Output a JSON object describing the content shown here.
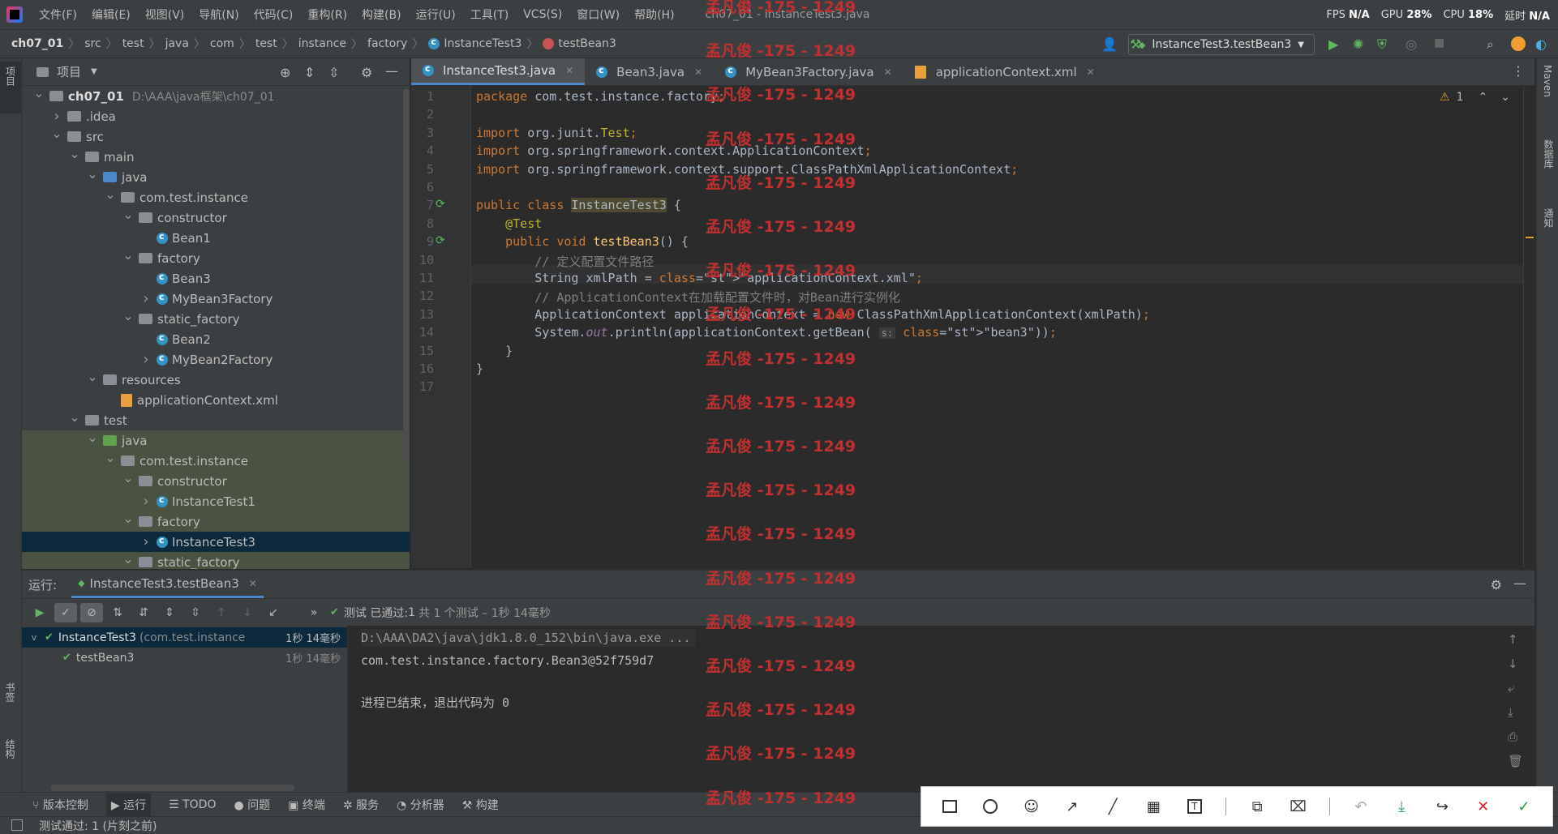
{
  "menubar": {
    "items": [
      "文件(F)",
      "编辑(E)",
      "视图(V)",
      "导航(N)",
      "代码(C)",
      "重构(R)",
      "构建(B)",
      "运行(U)",
      "工具(T)",
      "VCS(S)",
      "窗口(W)",
      "帮助(H)"
    ],
    "window_title": "ch07_01 - InstanceTest3.java",
    "fps_label": "FPS",
    "fps_value": "N/A",
    "gpu_label": "GPU",
    "gpu_value": "28%",
    "cpu_label": "CPU",
    "cpu_value": "18%",
    "latency_label": "延时",
    "latency_value": "N/A"
  },
  "breadcrumb": {
    "items": [
      "ch07_01",
      "src",
      "test",
      "java",
      "com",
      "test",
      "instance",
      "factory",
      "InstanceTest3",
      "testBean3"
    ],
    "run_config": "InstanceTest3.testBean3"
  },
  "left_strip": {
    "project": "项目",
    "bookmarks": "书签",
    "structure": "结构"
  },
  "right_strip": {
    "maven": "Maven",
    "database": "数据库",
    "notifications": "通知"
  },
  "project_panel": {
    "title": "项目",
    "tree": [
      {
        "label": "ch07_01",
        "extra": "D:\\AAA\\java框架\\ch07_01",
        "indent": 0,
        "arrow": "v",
        "icon": "folder"
      },
      {
        "label": ".idea",
        "indent": 1,
        "arrow": ">",
        "icon": "folder"
      },
      {
        "label": "src",
        "indent": 1,
        "arrow": "v",
        "icon": "folder"
      },
      {
        "label": "main",
        "indent": 2,
        "arrow": "v",
        "icon": "folder"
      },
      {
        "label": "java",
        "indent": 3,
        "arrow": "v",
        "icon": "folder-blue"
      },
      {
        "label": "com.test.instance",
        "indent": 4,
        "arrow": "v",
        "icon": "package"
      },
      {
        "label": "constructor",
        "indent": 5,
        "arrow": "v",
        "icon": "package"
      },
      {
        "label": "Bean1",
        "indent": 6,
        "arrow": "",
        "icon": "class"
      },
      {
        "label": "factory",
        "indent": 5,
        "arrow": "v",
        "icon": "package"
      },
      {
        "label": "Bean3",
        "indent": 6,
        "arrow": "",
        "icon": "class"
      },
      {
        "label": "MyBean3Factory",
        "indent": 6,
        "arrow": ">",
        "icon": "class"
      },
      {
        "label": "static_factory",
        "indent": 5,
        "arrow": "v",
        "icon": "package"
      },
      {
        "label": "Bean2",
        "indent": 6,
        "arrow": "",
        "icon": "class"
      },
      {
        "label": "MyBean2Factory",
        "indent": 6,
        "arrow": ">",
        "icon": "class"
      },
      {
        "label": "resources",
        "indent": 3,
        "arrow": "v",
        "icon": "folder"
      },
      {
        "label": "applicationContext.xml",
        "indent": 4,
        "arrow": "",
        "icon": "xml"
      },
      {
        "label": "test",
        "indent": 2,
        "arrow": "v",
        "icon": "folder"
      },
      {
        "label": "java",
        "indent": 3,
        "arrow": "v",
        "icon": "folder-green",
        "hl": true
      },
      {
        "label": "com.test.instance",
        "indent": 4,
        "arrow": "v",
        "icon": "package",
        "hl": true
      },
      {
        "label": "constructor",
        "indent": 5,
        "arrow": "v",
        "icon": "package",
        "hl": true
      },
      {
        "label": "InstanceTest1",
        "indent": 6,
        "arrow": ">",
        "icon": "class",
        "hl": true
      },
      {
        "label": "factory",
        "indent": 5,
        "arrow": "v",
        "icon": "package",
        "hl": true
      },
      {
        "label": "InstanceTest3",
        "indent": 6,
        "arrow": ">",
        "icon": "class",
        "sel": true
      },
      {
        "label": "static_factory",
        "indent": 5,
        "arrow": "v",
        "icon": "package",
        "hl": true
      }
    ]
  },
  "tabs": [
    {
      "label": "InstanceTest3.java",
      "icon": "class",
      "active": true
    },
    {
      "label": "Bean3.java",
      "icon": "class",
      "active": false
    },
    {
      "label": "MyBean3Factory.java",
      "icon": "class",
      "active": false
    },
    {
      "label": "applicationContext.xml",
      "icon": "xml",
      "active": false
    }
  ],
  "editor": {
    "warnings": "1",
    "lines": [
      "package com.test.instance.factory;",
      "",
      "import org.junit.Test;",
      "import org.springframework.context.ApplicationContext;",
      "import org.springframework.context.support.ClassPathXmlApplicationContext;",
      "",
      "public class InstanceTest3 {",
      "    @Test",
      "    public void testBean3() {",
      "        // 定义配置文件路径",
      "        String xmlPath = \"applicationContext.xml\";",
      "        // ApplicationContext在加载配置文件时，对Bean进行实例化",
      "        ApplicationContext applicationContext = new ClassPathXmlApplicationContext(xmlPath);",
      "        System.out.println(applicationContext.getBean( s: \"bean3\"));",
      "    }",
      "}",
      ""
    ]
  },
  "run_panel": {
    "label": "运行:",
    "tab": "InstanceTest3.testBean3",
    "status_prefix": "测试 已通过:",
    "status_count": "1",
    "status_detail": "共 1 个测试 – 1秒 14毫秒",
    "tree": [
      {
        "label": "InstanceTest3",
        "extra": "(com.test.instance",
        "time": "1秒 14毫秒"
      },
      {
        "label": "testBean3",
        "extra": "",
        "time": "1秒 14毫秒"
      }
    ],
    "console": [
      "D:\\AAA\\DA2\\java\\jdk1.8.0_152\\bin\\java.exe ...",
      "com.test.instance.factory.Bean3@52f759d7",
      "",
      "进程已结束，退出代码为 0"
    ]
  },
  "bottom_tools": [
    "版本控制",
    "运行",
    "TODO",
    "问题",
    "终端",
    "服务",
    "分析器",
    "构建"
  ],
  "status_bar": {
    "text": "测试通过: 1 (片刻之前)"
  },
  "watermark": {
    "text": "孟凡俊 -175 - 1249"
  },
  "colors": {
    "accent": "#4a88c7",
    "bg": "#2b2b2b",
    "panel": "#3c3f41",
    "watermark": "#c03030"
  }
}
